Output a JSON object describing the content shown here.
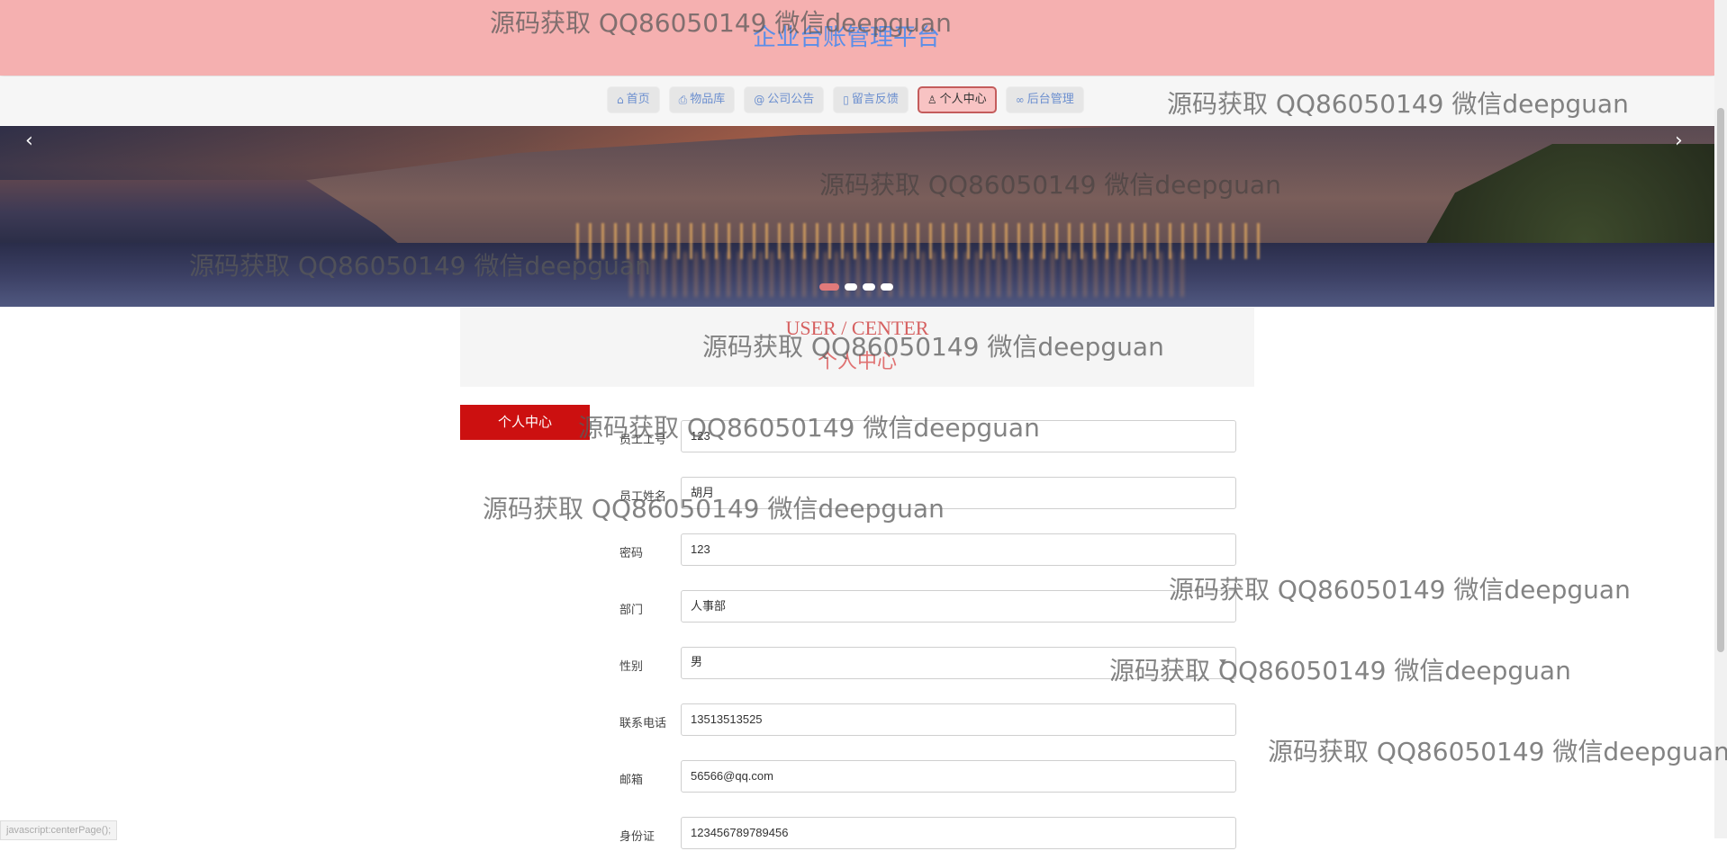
{
  "header": {
    "title": "企业台账管理平台"
  },
  "nav": {
    "items": [
      {
        "label": "首页",
        "icon": "home-icon"
      },
      {
        "label": "物品库",
        "icon": "print-icon"
      },
      {
        "label": "公司公告",
        "icon": "at-icon"
      },
      {
        "label": "留言反馈",
        "icon": "note-icon"
      },
      {
        "label": "个人中心",
        "icon": "user-icon",
        "active": true
      },
      {
        "label": "后台管理",
        "icon": "link-icon"
      }
    ]
  },
  "banner": {
    "prev": "‹",
    "next": "›",
    "slides": 4,
    "active_slide": 1
  },
  "section": {
    "title_en": "USER / CENTER",
    "title_cn": "个人中心"
  },
  "side_tab": {
    "label": "个人中心"
  },
  "form": {
    "fields": [
      {
        "label": "员工工号",
        "value": "123"
      },
      {
        "label": "员工姓名",
        "value": "胡月"
      },
      {
        "label": "密码",
        "value": "123"
      },
      {
        "label": "部门",
        "value": "人事部"
      },
      {
        "label": "性别",
        "value": "男"
      },
      {
        "label": "联系电话",
        "value": "13513513525"
      },
      {
        "label": "邮箱",
        "value": "56566@qq.com"
      },
      {
        "label": "身份证",
        "value": "123456789789456"
      }
    ]
  },
  "status_bar": {
    "text": "javascript:centerPage();"
  },
  "watermark": {
    "text": "源码获取 QQ86050149 微信deepguan"
  },
  "colors": {
    "header_bg": "#f5b0b0",
    "title": "#5b8ee8",
    "accent_red": "#cc1010",
    "section_title": "#d66060"
  }
}
